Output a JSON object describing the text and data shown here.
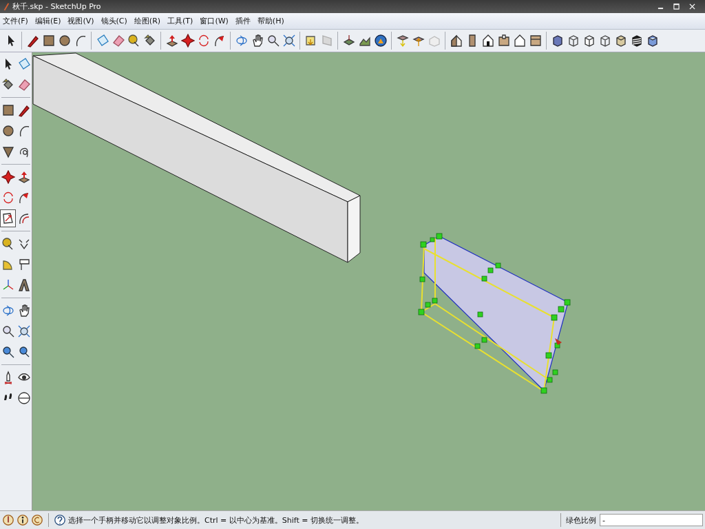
{
  "window": {
    "title": "秋千.skp - SketchUp Pro"
  },
  "menu": [
    {
      "label": "文件(F)"
    },
    {
      "label": "编辑(E)"
    },
    {
      "label": "视图(V)"
    },
    {
      "label": "镜头(C)"
    },
    {
      "label": "绘图(R)"
    },
    {
      "label": "工具(T)"
    },
    {
      "label": "窗口(W)"
    },
    {
      "label": "插件"
    },
    {
      "label": "帮助(H)"
    }
  ],
  "toolbar": [
    [
      {
        "kind": "select"
      }
    ],
    [
      {
        "kind": "pencil"
      },
      {
        "kind": "rect"
      },
      {
        "kind": "circle"
      },
      {
        "kind": "arc"
      }
    ],
    [
      {
        "kind": "component"
      },
      {
        "kind": "eraser"
      },
      {
        "kind": "tape"
      },
      {
        "kind": "paint"
      }
    ],
    [
      {
        "kind": "pushpull"
      },
      {
        "kind": "move"
      },
      {
        "kind": "rotate"
      },
      {
        "kind": "followme"
      }
    ],
    [
      {
        "kind": "orbit"
      },
      {
        "kind": "pan"
      },
      {
        "kind": "zoom"
      },
      {
        "kind": "zoomext"
      }
    ],
    [
      {
        "kind": "doc"
      },
      {
        "kind": "sheet"
      }
    ],
    [
      {
        "kind": "location"
      },
      {
        "kind": "terrain"
      },
      {
        "kind": "earth"
      }
    ],
    [
      {
        "kind": "boxdown"
      },
      {
        "kind": "boxup"
      },
      {
        "kind": "boxghost"
      }
    ],
    [
      {
        "kind": "house"
      },
      {
        "kind": "front"
      },
      {
        "kind": "houseline"
      },
      {
        "kind": "top"
      },
      {
        "kind": "houseback"
      },
      {
        "kind": "left"
      }
    ],
    [
      {
        "kind": "xray"
      },
      {
        "kind": "wire"
      },
      {
        "kind": "hidden"
      },
      {
        "kind": "wire"
      },
      {
        "kind": "shaded"
      },
      {
        "kind": "stripes"
      },
      {
        "kind": "facecube"
      }
    ]
  ],
  "left_toolbar": [
    [
      {
        "kind": "select",
        "selected": false
      },
      {
        "kind": "component",
        "selected": false
      },
      {
        "kind": "paint",
        "selected": false
      },
      {
        "kind": "eraser",
        "selected": false
      }
    ],
    [
      {
        "kind": "rect",
        "selected": false
      },
      {
        "kind": "pencil",
        "selected": false
      },
      {
        "kind": "circle",
        "selected": false
      },
      {
        "kind": "arc",
        "selected": false
      },
      {
        "kind": "polygon",
        "selected": false
      },
      {
        "kind": "freehand",
        "selected": false
      }
    ],
    [
      {
        "kind": "move",
        "selected": false
      },
      {
        "kind": "pushpull",
        "selected": false
      },
      {
        "kind": "rotate",
        "selected": false
      },
      {
        "kind": "followme",
        "selected": false
      },
      {
        "kind": "scale",
        "selected": true
      },
      {
        "kind": "offset",
        "selected": false
      }
    ],
    [
      {
        "kind": "tape",
        "selected": false
      },
      {
        "kind": "dim",
        "selected": false
      },
      {
        "kind": "protractor",
        "selected": false
      },
      {
        "kind": "text",
        "selected": false
      },
      {
        "kind": "axes",
        "selected": false
      },
      {
        "kind": "text3d",
        "selected": false
      }
    ],
    [
      {
        "kind": "orbit",
        "selected": false
      },
      {
        "kind": "pan",
        "selected": false
      },
      {
        "kind": "zoom",
        "selected": false
      },
      {
        "kind": "zoomext",
        "selected": false
      },
      {
        "kind": "zoomwin",
        "selected": false
      },
      {
        "kind": "prev",
        "selected": false
      }
    ],
    [
      {
        "kind": "position",
        "selected": false
      },
      {
        "kind": "look",
        "selected": false
      },
      {
        "kind": "walk",
        "selected": false
      },
      {
        "kind": "section",
        "selected": false
      }
    ]
  ],
  "status_bar": {
    "message": "选择一个手柄并移动它以调整对象比例。Ctrl = 以中心为基准。Shift = 切换统一调整。",
    "measure_label": "绿色比例",
    "measure_value": "-"
  }
}
